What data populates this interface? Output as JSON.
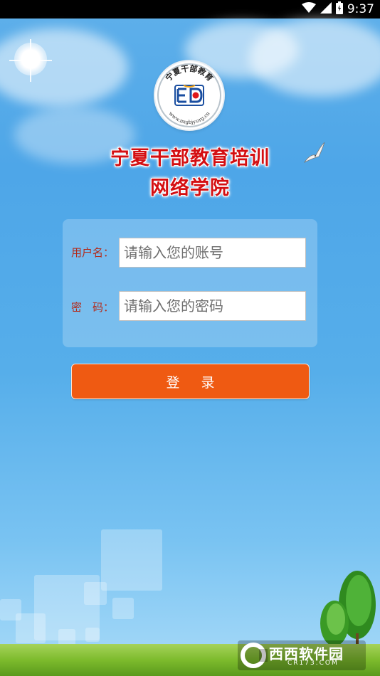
{
  "status_bar": {
    "time": "9:37",
    "icons": [
      "wifi-icon",
      "signal-icon",
      "battery-icon"
    ]
  },
  "logo": {
    "arc_text": "宁夏干部教育",
    "url_text": "www.nxgbjy.org.cn"
  },
  "header": {
    "title_line1": "宁夏干部教育培训",
    "title_line2": "网络学院"
  },
  "login_form": {
    "username_label": "用户名：",
    "username_placeholder": "请输入您的账号",
    "password_label": "密　码：",
    "password_placeholder": "请输入您的密码",
    "submit_label": "登录"
  },
  "watermark": {
    "text": "西西软件园",
    "domain": "CR173.COM"
  },
  "colors": {
    "title_red": "#d40f12",
    "button_orange": "#ef5a12",
    "label_red": "#b32a1a",
    "sky_blue": "#4ea6e8"
  }
}
